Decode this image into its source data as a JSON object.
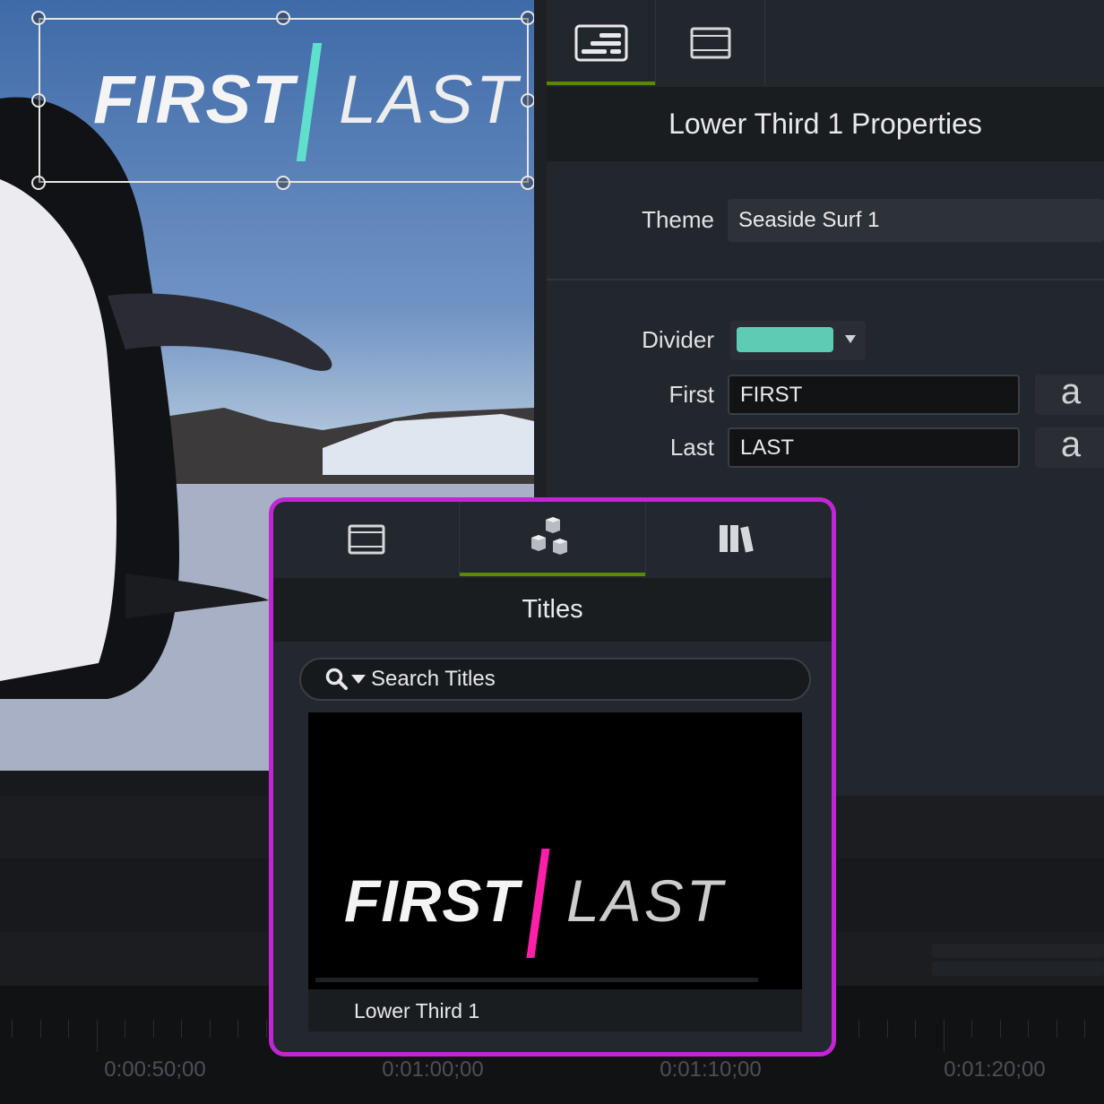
{
  "preview": {
    "overlay_first": "FIRST",
    "overlay_last": "LAST",
    "divider_color": "#5fe0cc"
  },
  "properties": {
    "tabs": [
      {
        "icon": "lower-third-properties-icon",
        "active": true
      },
      {
        "icon": "film-icon",
        "active": false
      }
    ],
    "title": "Lower Third 1 Properties",
    "theme_label": "Theme",
    "theme_value": "Seaside Surf 1",
    "divider_label": "Divider",
    "divider_color": "#5ecbb5",
    "first_label": "First",
    "first_value": "FIRST",
    "last_label": "Last",
    "last_value": "LAST",
    "font_button": "a"
  },
  "library": {
    "tabs": [
      {
        "icon": "film-icon",
        "active": false
      },
      {
        "icon": "cubes-icon",
        "active": true
      },
      {
        "icon": "library-books-icon",
        "active": false
      }
    ],
    "title": "Titles",
    "search_placeholder": "Search Titles",
    "item": {
      "thumb_first": "FIRST",
      "thumb_last": "LAST",
      "divider_color": "#ff1fa8",
      "name": "Lower Third 1"
    }
  },
  "timeline": {
    "timecodes": [
      "0:00:50;00",
      "0:01:00;00",
      "0:01:10;00",
      "0:01:20;00"
    ]
  },
  "colors": {
    "accent_green": "#5a8a00",
    "highlight_magenta": "#c026d3"
  }
}
